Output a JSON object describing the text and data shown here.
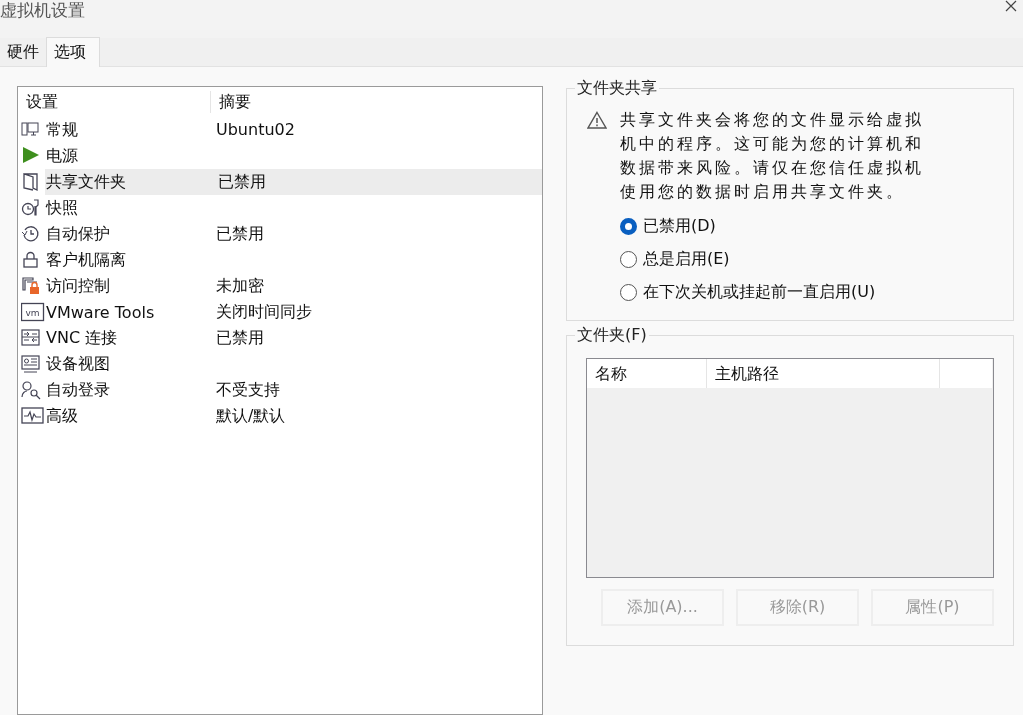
{
  "window": {
    "title": "虚拟机设置"
  },
  "tabs": [
    {
      "label": "硬件",
      "selected": false
    },
    {
      "label": "选项",
      "selected": true
    }
  ],
  "settings": {
    "columns": [
      "设置",
      "摘要"
    ],
    "rows": [
      {
        "name": "常规",
        "summary": "Ubuntu02",
        "selected": false
      },
      {
        "name": "电源",
        "summary": "",
        "selected": false
      },
      {
        "name": "共享文件夹",
        "summary": "已禁用",
        "selected": true
      },
      {
        "name": "快照",
        "summary": "",
        "selected": false
      },
      {
        "name": "自动保护",
        "summary": "已禁用",
        "selected": false
      },
      {
        "name": "客户机隔离",
        "summary": "",
        "selected": false
      },
      {
        "name": "访问控制",
        "summary": "未加密",
        "selected": false
      },
      {
        "name": "VMware Tools",
        "summary": "关闭时间同步",
        "selected": false,
        "icon_text": "vm"
      },
      {
        "name": "VNC 连接",
        "summary": "已禁用",
        "selected": false
      },
      {
        "name": "设备视图",
        "summary": "",
        "selected": false
      },
      {
        "name": "自动登录",
        "summary": "不受支持",
        "selected": false
      },
      {
        "name": "高级",
        "summary": "默认/默认",
        "selected": false
      }
    ]
  },
  "sharing": {
    "title": "文件夹共享",
    "warning": "共享文件夹会将您的文件显示给虚拟机中的程序。这可能为您的计算机和数据带来风险。请仅在您信任虚拟机使用您的数据时启用共享文件夹。",
    "options": [
      {
        "label": "已禁用(D)",
        "selected": true
      },
      {
        "label": "总是启用(E)",
        "selected": false
      },
      {
        "label": "在下次关机或挂起前一直启用(U)",
        "selected": false
      }
    ]
  },
  "folders": {
    "title": "文件夹(F)",
    "columns": [
      "名称",
      "主机路径"
    ],
    "buttons": [
      {
        "label": "添加(A)...",
        "disabled": true
      },
      {
        "label": "移除(R)",
        "disabled": true
      },
      {
        "label": "属性(P)",
        "disabled": true
      }
    ]
  }
}
